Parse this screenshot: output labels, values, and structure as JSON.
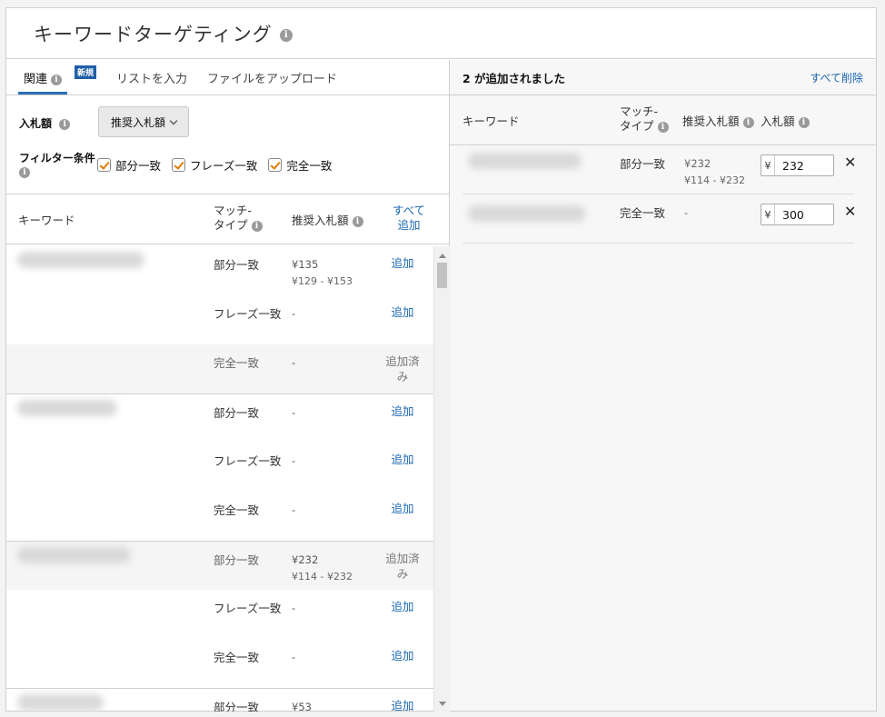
{
  "header": {
    "title": "キーワードターゲティング"
  },
  "tabs": [
    {
      "label": "関連",
      "badge": "新規"
    },
    {
      "label": "リストを入力"
    },
    {
      "label": "ファイルをアップロード"
    }
  ],
  "filters": {
    "bid_label": "入札額",
    "bid_dropdown": "推奨入札額",
    "filter_label": "フィルター条件",
    "options": [
      "部分一致",
      "フレーズ一致",
      "完全一致"
    ]
  },
  "left_table": {
    "headers": {
      "keyword": "キーワード",
      "match_type_1": "マッチ-",
      "match_type_2": "タイプ",
      "suggested_bid": "推奨入札額",
      "add_all_1": "すべて",
      "add_all_2": "追加"
    },
    "rows": [
      {
        "match": "部分一致",
        "bid": "¥135",
        "range": "¥129 - ¥153",
        "action": "追加"
      },
      {
        "match": "フレーズ一致",
        "bid": "-",
        "range": "",
        "action": "追加"
      },
      {
        "match": "完全一致",
        "bid": "-",
        "range": "",
        "action_1": "追加済",
        "action_2": "み"
      },
      {
        "match": "部分一致",
        "bid": "-",
        "range": "",
        "action": "追加"
      },
      {
        "match": "フレーズ一致",
        "bid": "-",
        "range": "",
        "action": "追加"
      },
      {
        "match": "完全一致",
        "bid": "-",
        "range": "",
        "action": "追加"
      },
      {
        "match": "部分一致",
        "bid": "¥232",
        "range": "¥114 - ¥232",
        "action_1": "追加済",
        "action_2": "み"
      },
      {
        "match": "フレーズ一致",
        "bid": "-",
        "range": "",
        "action": "追加"
      },
      {
        "match": "完全一致",
        "bid": "-",
        "range": "",
        "action": "追加"
      },
      {
        "match": "部分一致",
        "bid": "¥53",
        "range": "",
        "action": "追加"
      }
    ]
  },
  "right_panel": {
    "count_text": "2 が追加されました",
    "remove_all": "すべて削除",
    "headers": {
      "keyword": "キーワード",
      "match_type_1": "マッチ-",
      "match_type_2": "タイプ",
      "suggested_bid": "推奨入札額",
      "bid": "入札額"
    },
    "rows": [
      {
        "match": "部分一致",
        "bid": "¥232",
        "range": "¥114 - ¥232",
        "currency": "¥",
        "value": "232"
      },
      {
        "match": "完全一致",
        "bid": "-",
        "range": "",
        "currency": "¥",
        "value": "300"
      }
    ]
  }
}
